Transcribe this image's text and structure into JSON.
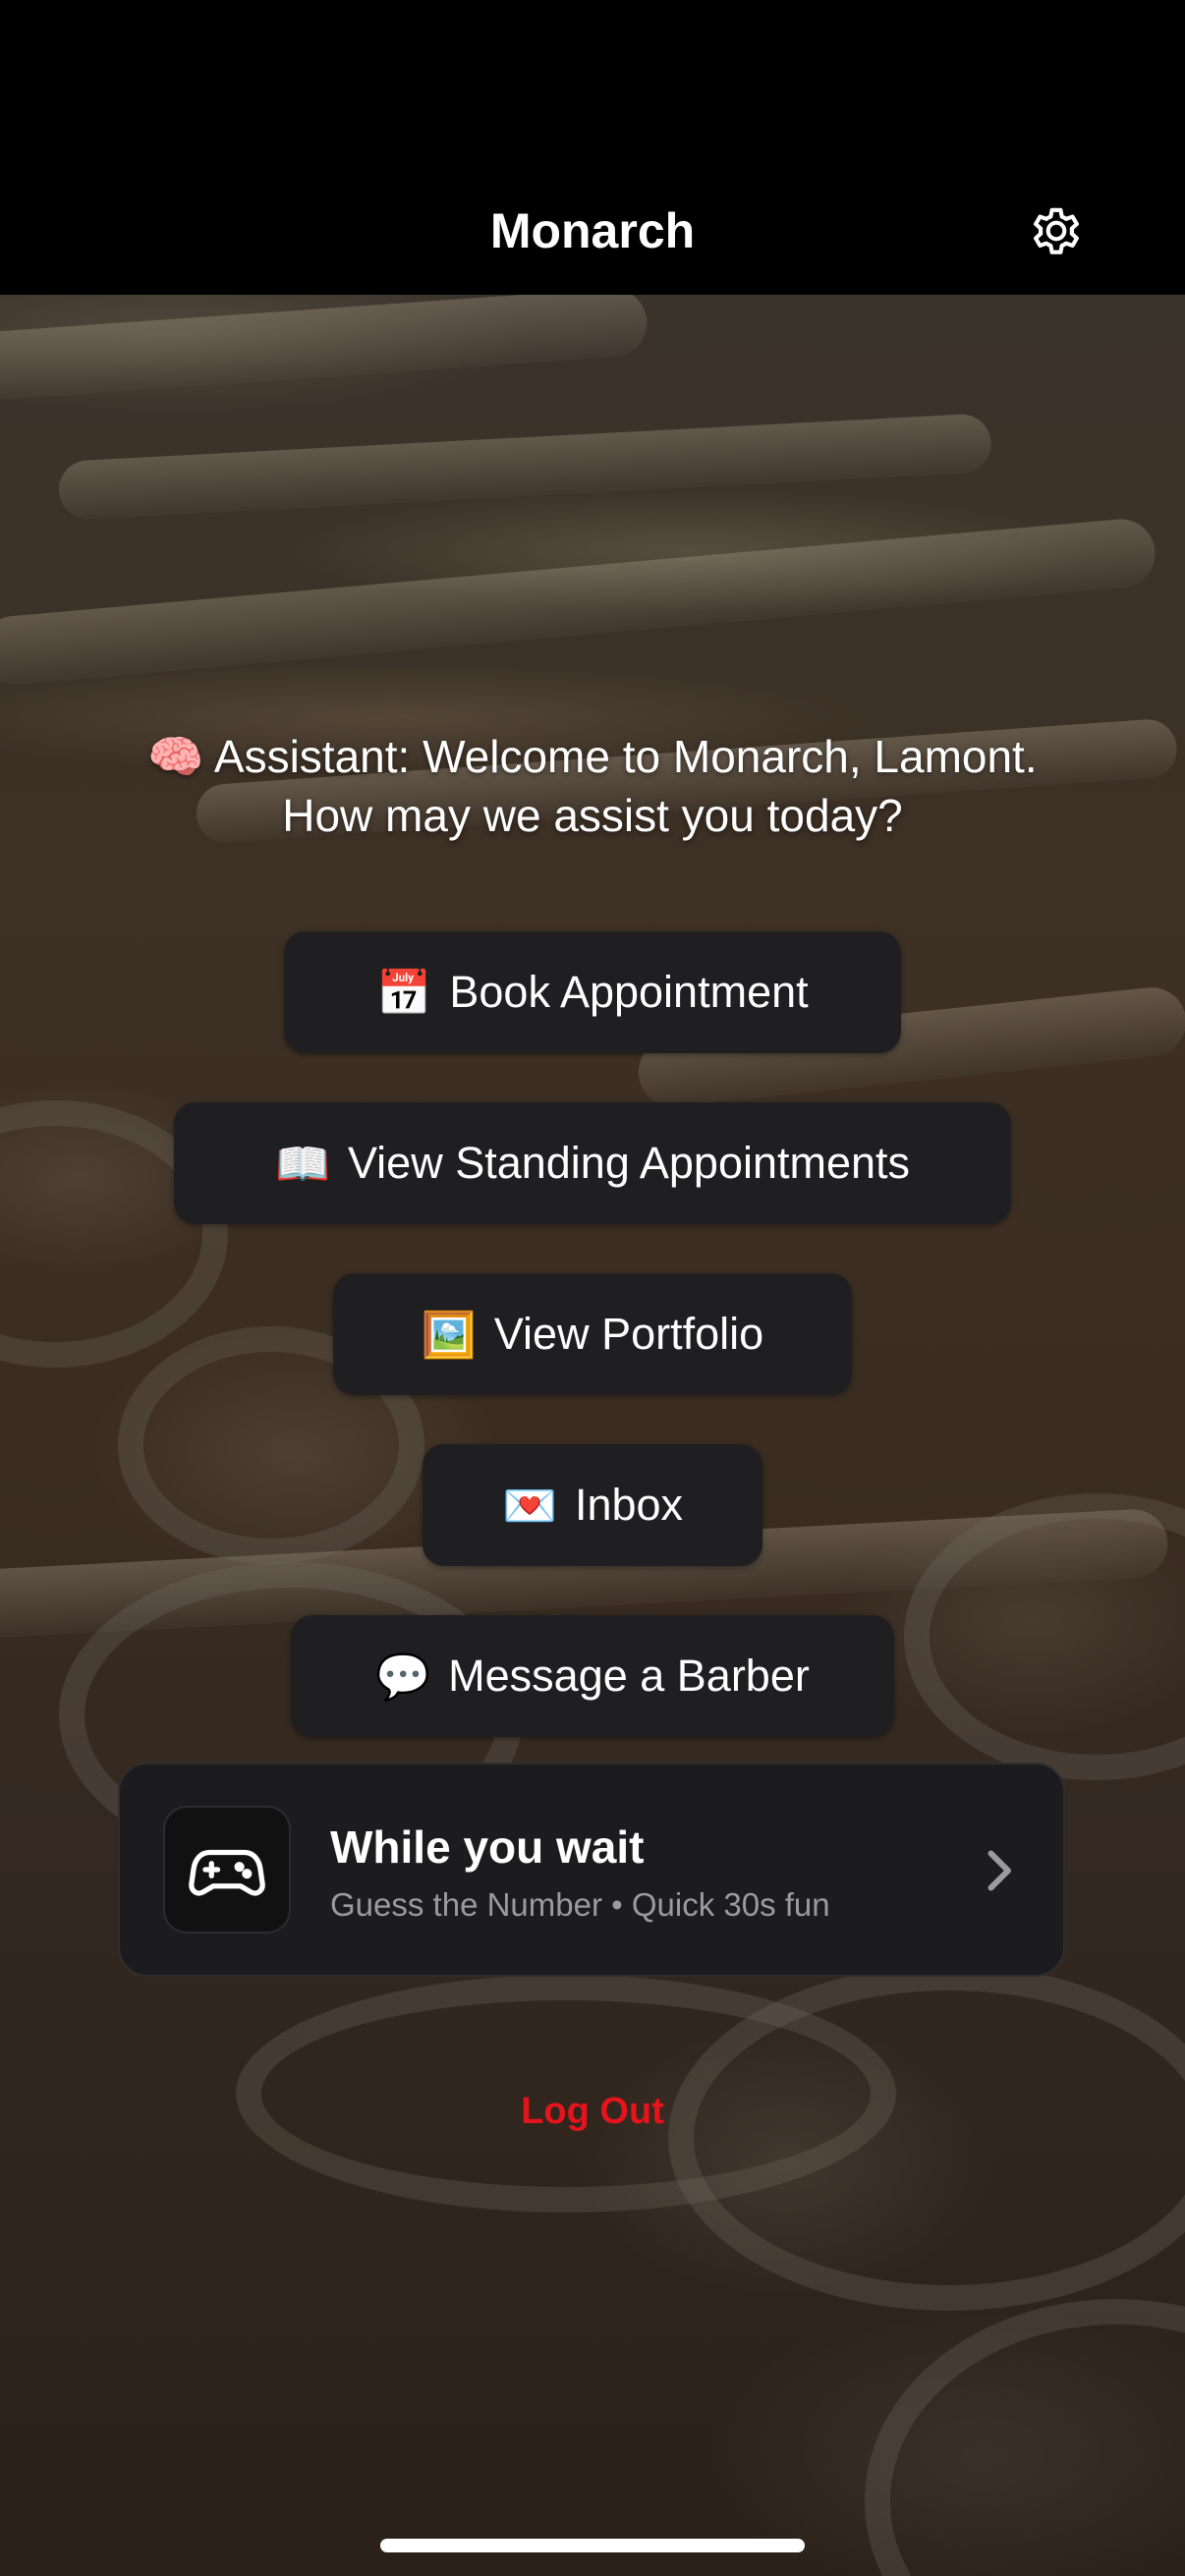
{
  "nav": {
    "title": "Monarch",
    "settings_icon": "gear-icon"
  },
  "assistant": {
    "emoji": "🧠",
    "message": "Assistant: Welcome to Monarch, Lamont. How may we assist you today?"
  },
  "actions": [
    {
      "emoji": "📅",
      "label": "Book Appointment"
    },
    {
      "emoji": "📖",
      "label": "View Standing Appointments"
    },
    {
      "emoji": "🖼️",
      "label": "View Portfolio"
    },
    {
      "emoji": "💌",
      "label": "Inbox"
    },
    {
      "emoji": "💬",
      "label": "Message a Barber"
    }
  ],
  "wait_card": {
    "icon": "gamepad-icon",
    "title": "While you wait",
    "subtitle": "Guess the Number • Quick 30s fun",
    "chevron_icon": "chevron-right-icon"
  },
  "logout": {
    "label": "Log Out"
  },
  "colors": {
    "button_bg": "#1f1f21",
    "logout_red": "#e5131b",
    "card_bg": "#1c1c1e",
    "subtitle_gray": "#9a9a9f"
  }
}
